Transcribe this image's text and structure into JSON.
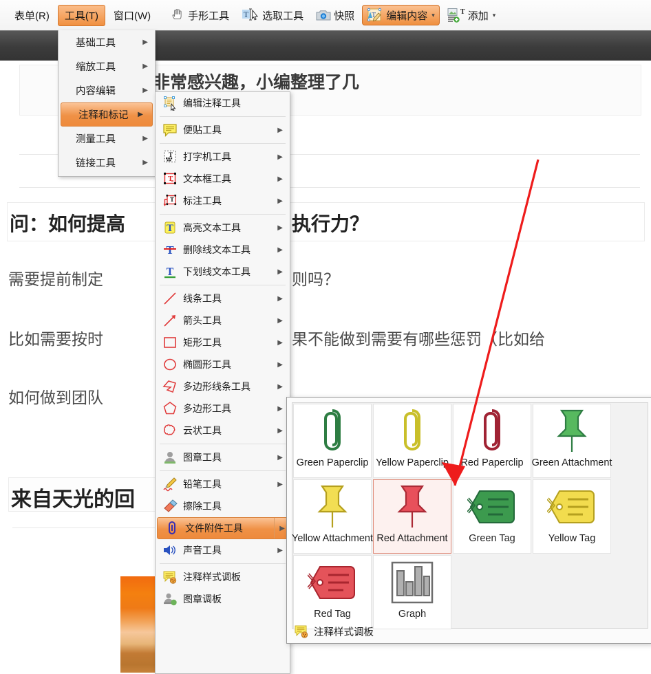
{
  "menubar": {
    "items": [
      {
        "label": "表单(R)",
        "name": "menu-form",
        "active": false
      },
      {
        "label": "工具(T)",
        "name": "menu-tools",
        "active": true
      },
      {
        "label": "窗口(W)",
        "name": "menu-window",
        "active": false
      }
    ],
    "toolbuttons": [
      {
        "label": "手形工具",
        "icon": "hand-icon",
        "name": "hand-tool",
        "active": false
      },
      {
        "label": "选取工具",
        "icon": "select-text-icon",
        "name": "select-tool",
        "active": false
      },
      {
        "label": "快照",
        "icon": "camera-icon",
        "name": "snapshot-tool",
        "active": false
      },
      {
        "label": "编辑内容",
        "icon": "edit-content-icon",
        "name": "edit-content-tool",
        "active": true,
        "caret": "▾"
      },
      {
        "label": "添加",
        "icon": "add-icon",
        "name": "add-tool",
        "active": false,
        "caret": "▾"
      }
    ]
  },
  "tools_menu": {
    "items": [
      {
        "label": "基础工具",
        "name": "basic-tools",
        "arrow": "▶",
        "selected": false
      },
      {
        "label": "缩放工具",
        "name": "zoom-tools",
        "arrow": "▶",
        "selected": false
      },
      {
        "label": "内容编辑",
        "name": "content-edit",
        "arrow": "▶",
        "selected": false
      },
      {
        "label": "注释和标记",
        "name": "annotate-mark",
        "arrow": "▶",
        "selected": true
      },
      {
        "label": "测量工具",
        "name": "measure-tools",
        "arrow": "▶",
        "selected": false
      },
      {
        "label": "链接工具",
        "name": "link-tools",
        "arrow": "▶",
        "selected": false
      }
    ]
  },
  "annotation_menu": {
    "items": [
      {
        "label": "编辑注释工具",
        "icon": "edit-annotation-icon",
        "arrow": "",
        "selected": false,
        "sep_after": true
      },
      {
        "label": "便贴工具",
        "icon": "sticky-note-icon",
        "arrow": "▶",
        "selected": false,
        "sep_after": true
      },
      {
        "label": "打字机工具",
        "icon": "typewriter-icon",
        "arrow": "▶",
        "selected": false,
        "sep_after": false
      },
      {
        "label": "文本框工具",
        "icon": "textbox-icon",
        "arrow": "▶",
        "selected": false,
        "sep_after": false
      },
      {
        "label": "标注工具",
        "icon": "callout-icon",
        "arrow": "▶",
        "selected": false,
        "sep_after": true
      },
      {
        "label": "高亮文本工具",
        "icon": "highlight-text-icon",
        "arrow": "▶",
        "selected": false,
        "sep_after": false
      },
      {
        "label": "删除线文本工具",
        "icon": "strikeout-text-icon",
        "arrow": "▶",
        "selected": false,
        "sep_after": false
      },
      {
        "label": "下划线文本工具",
        "icon": "underline-text-icon",
        "arrow": "▶",
        "selected": false,
        "sep_after": true
      },
      {
        "label": "线条工具",
        "icon": "line-icon",
        "arrow": "▶",
        "selected": false,
        "sep_after": false
      },
      {
        "label": "箭头工具",
        "icon": "arrow-icon",
        "arrow": "▶",
        "selected": false,
        "sep_after": false
      },
      {
        "label": "矩形工具",
        "icon": "rectangle-icon",
        "arrow": "▶",
        "selected": false,
        "sep_after": false
      },
      {
        "label": "椭圆形工具",
        "icon": "ellipse-icon",
        "arrow": "▶",
        "selected": false,
        "sep_after": false
      },
      {
        "label": "多边形线条工具",
        "icon": "polyline-icon",
        "arrow": "▶",
        "selected": false,
        "sep_after": false
      },
      {
        "label": "多边形工具",
        "icon": "polygon-icon",
        "arrow": "▶",
        "selected": false,
        "sep_after": false
      },
      {
        "label": "云状工具",
        "icon": "cloud-icon",
        "arrow": "▶",
        "selected": false,
        "sep_after": true
      },
      {
        "label": "图章工具",
        "icon": "stamp-icon",
        "arrow": "▶",
        "selected": false,
        "sep_after": true
      },
      {
        "label": "铅笔工具",
        "icon": "pencil-icon",
        "arrow": "▶",
        "selected": false,
        "sep_after": false
      },
      {
        "label": "擦除工具",
        "icon": "eraser-icon",
        "arrow": "",
        "selected": false,
        "sep_after": false
      },
      {
        "label": "文件附件工具",
        "icon": "file-attachment-icon",
        "arrow": "▶",
        "selected": true,
        "sep_after": false
      },
      {
        "label": "声音工具",
        "icon": "sound-icon",
        "arrow": "▶",
        "selected": false,
        "sep_after": true
      },
      {
        "label": "注释样式调板",
        "icon": "annotation-style-palette-icon",
        "arrow": "",
        "selected": false,
        "sep_after": false
      },
      {
        "label": "图章调板",
        "icon": "stamp-palette-icon",
        "arrow": "",
        "selected": false,
        "sep_after": false
      }
    ]
  },
  "attachment_palette": {
    "items": [
      {
        "label": "Green Paperclip",
        "icon": "paperclip-icon",
        "color": "#2e7d43",
        "shape": "clip",
        "selected": false
      },
      {
        "label": "Yellow Paperclip",
        "icon": "paperclip-icon",
        "color": "#c9bf2a",
        "shape": "clip",
        "selected": false
      },
      {
        "label": "Red Paperclip",
        "icon": "paperclip-icon",
        "color": "#a02334",
        "shape": "clip",
        "selected": false
      },
      {
        "label": "Green Attachment",
        "icon": "pushpin-icon",
        "color": "#57b95f",
        "shape": "pin",
        "selected": false
      },
      {
        "label": "Yellow Attachment",
        "icon": "pushpin-icon",
        "color": "#f2de53",
        "shape": "pin",
        "selected": false
      },
      {
        "label": "Red Attachment",
        "icon": "pushpin-icon",
        "color": "#e8505b",
        "shape": "pin",
        "selected": true
      },
      {
        "label": "Green Tag",
        "icon": "tag-icon",
        "color": "#3c9a4e",
        "shape": "tag",
        "selected": false
      },
      {
        "label": "Yellow Tag",
        "icon": "tag-icon",
        "color": "#f2dc4e",
        "shape": "tag",
        "selected": false
      },
      {
        "label": "Red Tag",
        "icon": "tag-icon",
        "color": "#e4535a",
        "shape": "tag",
        "selected": false
      },
      {
        "label": "Graph",
        "icon": "graph-icon",
        "color": "#a6a6a6",
        "shape": "graph",
        "selected": false
      }
    ],
    "footer_label": "注释样式调板",
    "footer_icon": "annotation-style-palette-icon"
  },
  "document": {
    "top_text": "和执行力非常感兴趣，小编整理了几",
    "lines": [
      {
        "text": "问：如何提高",
        "text2": "执行力？",
        "style": "head"
      },
      {
        "text": "需要提前制定",
        "text2": "则吗？",
        "style": "sub"
      },
      {
        "text": "比如需要按时",
        "text2": "果不能做到需要有哪些惩罚（比如给",
        "style": "sub"
      },
      {
        "text": "如何做到团队",
        "text2": "",
        "style": "sub"
      }
    ],
    "section_title": "来自天光的回"
  },
  "annotation": {
    "arrow_color": "#ee1c1c",
    "arrow_name": "red-annotation-arrow"
  }
}
